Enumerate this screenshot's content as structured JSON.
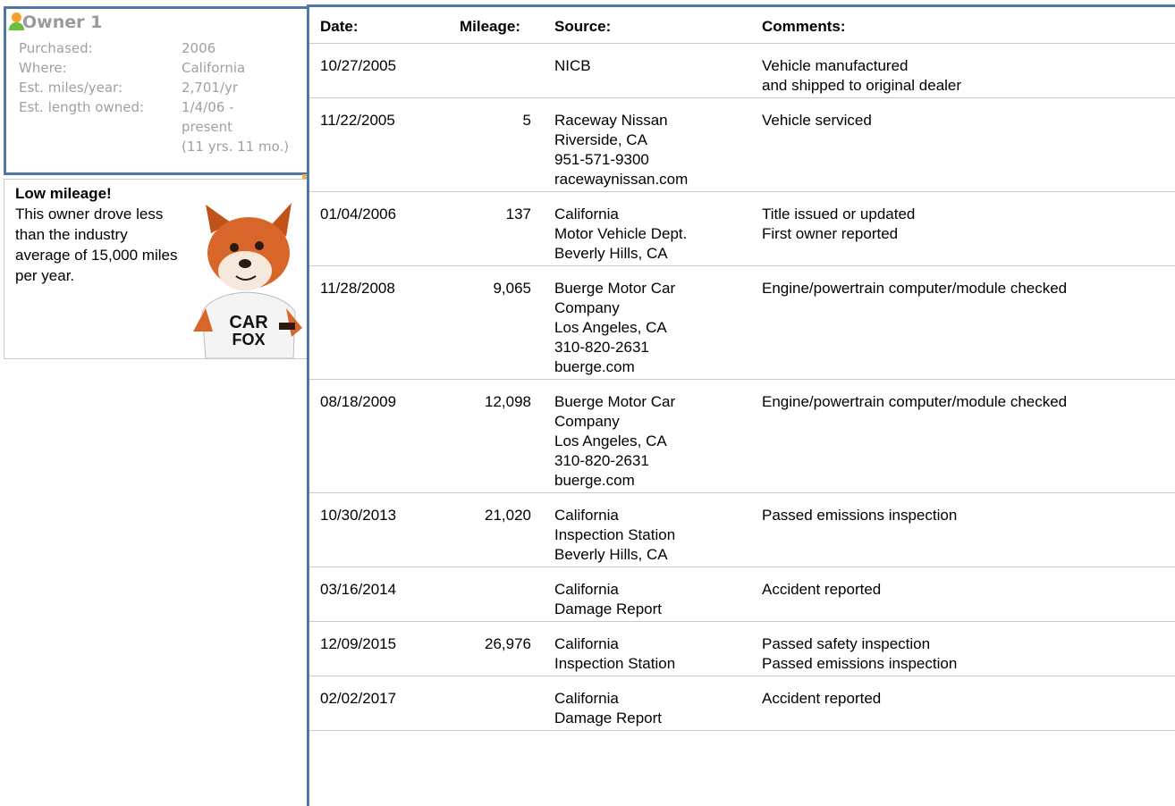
{
  "owner": {
    "title": "Owner 1",
    "rows": [
      {
        "label": "Purchased:",
        "value": "2006"
      },
      {
        "label": "Where:",
        "value": "California"
      },
      {
        "label": "Est. miles/year:",
        "value": "2,701/yr"
      },
      {
        "label": "Est. length owned:",
        "value": "1/4/06 -"
      },
      {
        "label": "",
        "value": "present"
      },
      {
        "label": "",
        "value": "(11 yrs. 11 mo.)"
      }
    ]
  },
  "low_mileage": {
    "heading": "Low mileage!",
    "body": "This owner drove less than the industry average of 15,000 miles per year.",
    "mascot_text": "CAR FOX"
  },
  "history": {
    "headers": {
      "date": "Date:",
      "mileage": "Mileage:",
      "source": "Source:",
      "comments": "Comments:"
    },
    "rows": [
      {
        "date": "10/27/2005",
        "mileage": "",
        "source": "NICB",
        "comments": "Vehicle manufactured\nand shipped to original dealer"
      },
      {
        "date": "11/22/2005",
        "mileage": "5",
        "source": "Raceway Nissan\nRiverside, CA\n951-571-9300\nracewaynissan.com",
        "comments": "Vehicle serviced"
      },
      {
        "date": "01/04/2006",
        "mileage": "137",
        "source": "California\nMotor Vehicle Dept.\nBeverly Hills, CA",
        "comments": "Title issued or updated\nFirst owner reported"
      },
      {
        "date": "11/28/2008",
        "mileage": "9,065",
        "source": "Buerge Motor Car\nCompany\nLos Angeles, CA\n310-820-2631\nbuerge.com",
        "comments": "Engine/powertrain computer/module checked"
      },
      {
        "date": "08/18/2009",
        "mileage": "12,098",
        "source": "Buerge Motor Car\nCompany\nLos Angeles, CA\n310-820-2631\nbuerge.com",
        "comments": "Engine/powertrain computer/module checked"
      },
      {
        "date": "10/30/2013",
        "mileage": "21,020",
        "source": "California\nInspection Station\nBeverly Hills, CA",
        "comments": "Passed emissions inspection"
      },
      {
        "date": "03/16/2014",
        "mileage": "",
        "source": "California\nDamage Report",
        "comments": "Accident reported"
      },
      {
        "date": "12/09/2015",
        "mileage": "26,976",
        "source": "California\nInspection Station",
        "comments": "Passed safety inspection\nPassed emissions inspection"
      },
      {
        "date": "02/02/2017",
        "mileage": "",
        "source": "California\nDamage Report",
        "comments": "Accident reported"
      }
    ]
  },
  "colors": {
    "accent": "#4f76a8",
    "muted_text": "#a0a0a0",
    "divider": "#c9c9c9"
  }
}
